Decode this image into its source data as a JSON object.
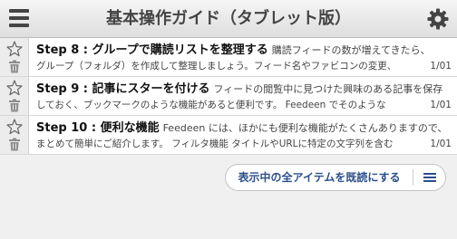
{
  "header": {
    "title": "基本操作ガイド（タブレット版）",
    "menu_icon": "hamburger-menu-icon",
    "settings_icon": "gear-icon"
  },
  "items": [
    {
      "title": "Step 8 : グループで購読リストを整理する",
      "snippet1": "購読フィードの数が増えてきたら、",
      "snippet2": "グループ（フォルダ）を作成して整理しましょう。フィード名やファビコンの変更、",
      "date": "1/01"
    },
    {
      "title": "Step 9 : 記事にスターを付ける",
      "snippet1": "フィードの閲覧中に見つけた興味のある記事を保存",
      "snippet2": "しておく、ブックマークのような機能があると便利です。 Feedeen でそのような",
      "date": "1/01"
    },
    {
      "title": "Step 10 : 便利な機能",
      "snippet1": "Feedeen には、ほかにも便利な機能がたくさんありますので、",
      "snippet2": "まとめて簡単にご紹介します。 フィルタ機能 タイトルやURLに特定の文字列を含む",
      "date": "1/01"
    }
  ],
  "footer": {
    "mark_all_read_label": "表示中の全アイテムを既読にする",
    "list_menu_icon": "list-menu-icon"
  },
  "colors": {
    "accent": "#2c4f8a",
    "header_bg": "#e6e6e6",
    "icon_gray": "#555555"
  }
}
